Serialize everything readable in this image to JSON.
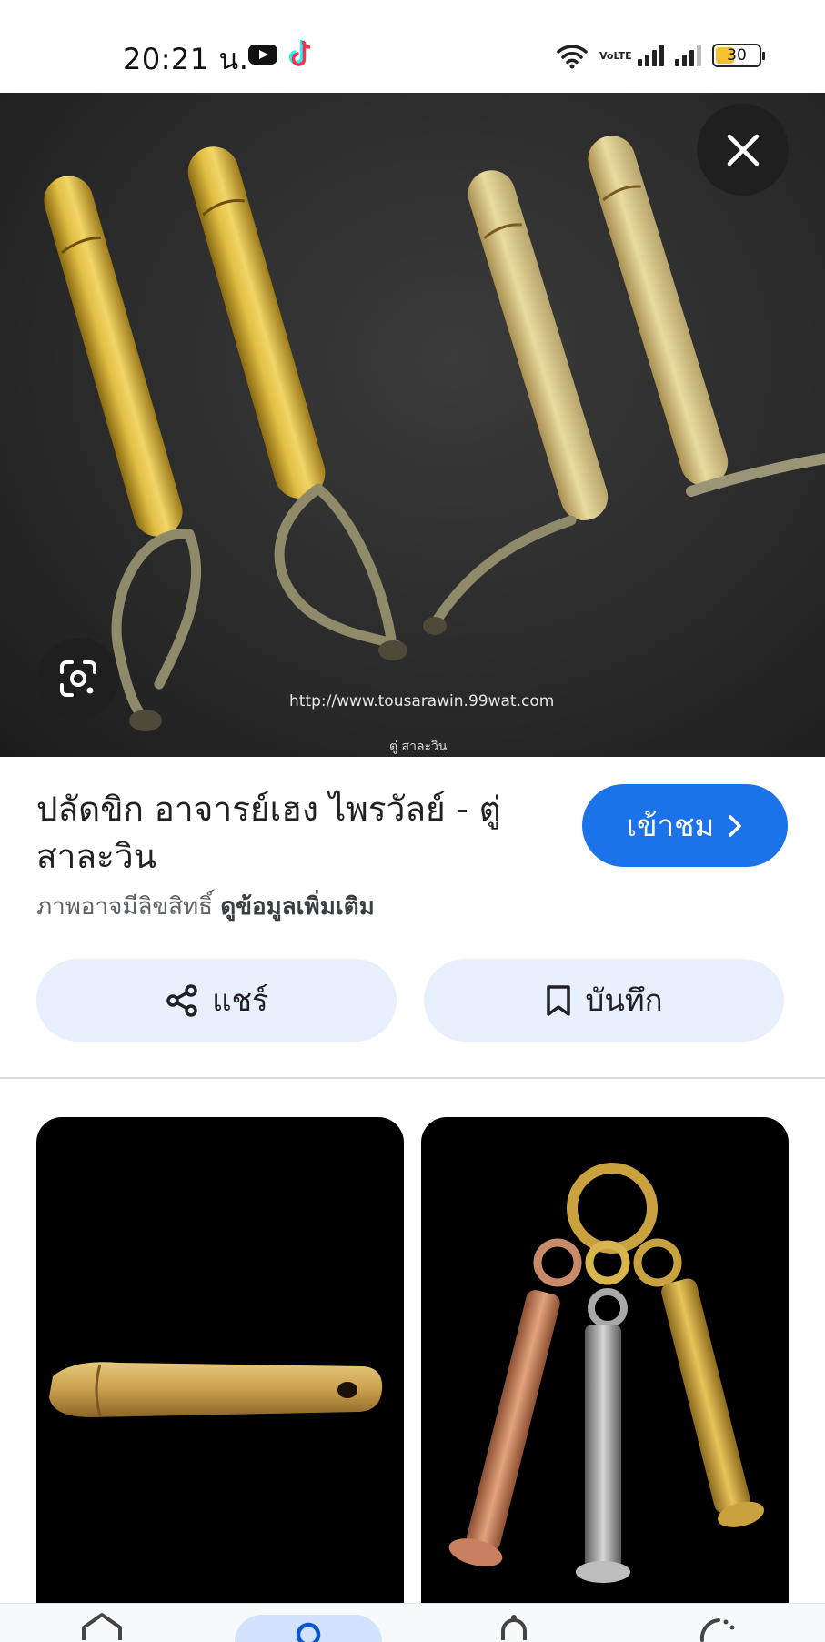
{
  "status_bar": {
    "time": "20:21 น.",
    "network_label": "VoLTE",
    "battery_level": "30"
  },
  "hero": {
    "watermark": "http://www.tousarawin.99wat.com",
    "caption": "ตู่ สาละวิน"
  },
  "result": {
    "title": "ปลัดขิก อาจารย์เฮง ไพรวัลย์ - ตู่ สาละวิน",
    "visit_label": "เข้าชม",
    "copyright_text": "ภาพอาจมีลิขสิทธิ์",
    "more_info_link": "ดูข้อมูลเพิ่มเติม"
  },
  "actions": {
    "share_label": "แชร์",
    "save_label": "บันทึก"
  },
  "colors": {
    "accent": "#1a73e8",
    "action_bg": "#e8f0fe",
    "nav_selected": "#d3e3fd"
  },
  "icons": {
    "close": "close-icon",
    "lens": "google-lens-icon",
    "visit": "chevron-right-icon",
    "share": "share-icon",
    "save": "bookmark-icon",
    "nav": [
      "home-icon",
      "search-icon",
      "notifications-icon",
      "history-icon"
    ]
  }
}
